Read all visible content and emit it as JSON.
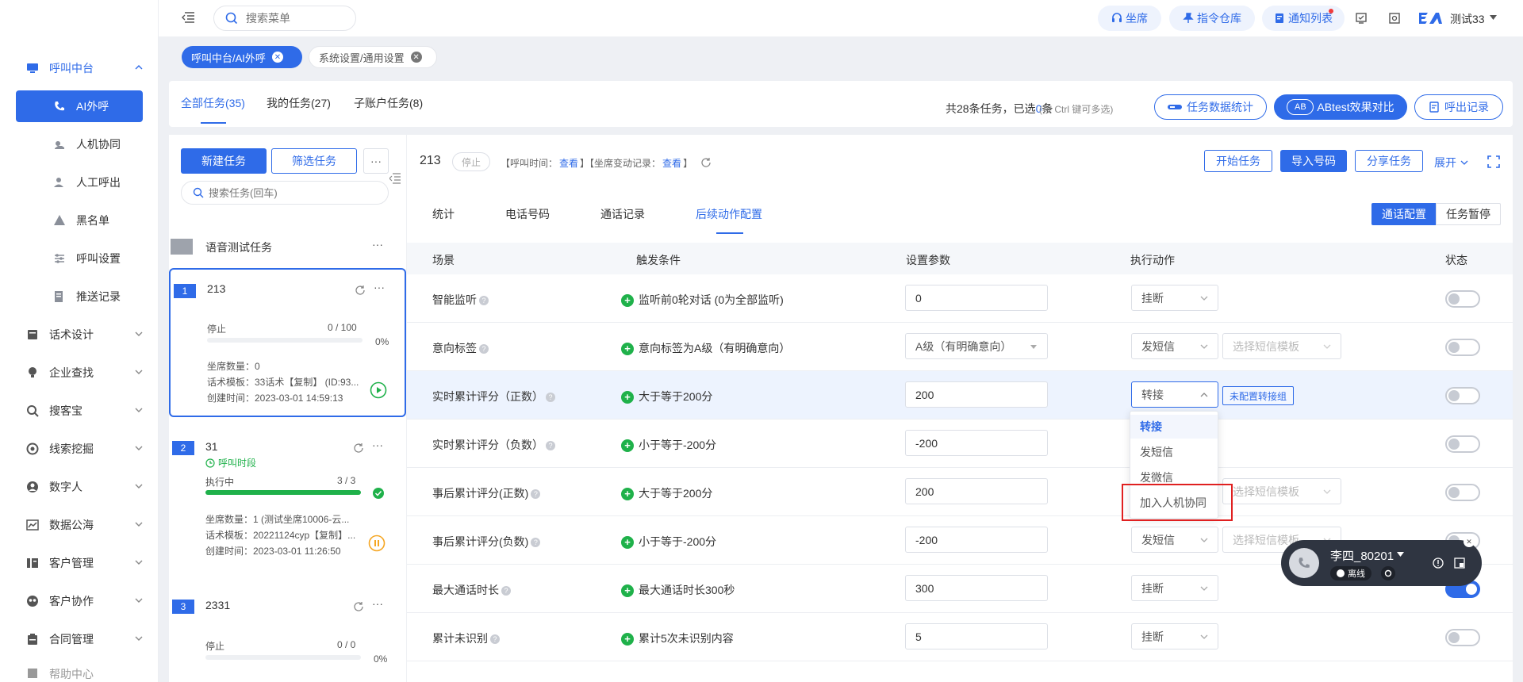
{
  "topbar": {
    "search_placeholder": "搜索菜单",
    "pills": [
      "坐席",
      "指令仓库",
      "通知列表"
    ],
    "user_name": "测试33",
    "logo_text": "E/"
  },
  "sidebar": {
    "items": [
      {
        "label": "呼叫中台",
        "type": "parent-open",
        "icon": "monitor-icon"
      },
      {
        "label": "AI外呼",
        "type": "active",
        "icon": "phone-icon"
      },
      {
        "label": "人机协同",
        "type": "sub",
        "icon": "hand-icon"
      },
      {
        "label": "人工呼出",
        "type": "sub",
        "icon": "user-icon"
      },
      {
        "label": "黑名单",
        "type": "sub",
        "icon": "warning-icon"
      },
      {
        "label": "呼叫设置",
        "type": "sub",
        "icon": "sliders-icon"
      },
      {
        "label": "推送记录",
        "type": "sub",
        "icon": "record-icon"
      },
      {
        "label": "话术设计",
        "type": "parent",
        "icon": "script-icon"
      },
      {
        "label": "企业查找",
        "type": "parent",
        "icon": "bulb-icon"
      },
      {
        "label": "搜客宝",
        "type": "parent",
        "icon": "search-icon"
      },
      {
        "label": "线索挖掘",
        "type": "parent",
        "icon": "target-icon"
      },
      {
        "label": "数字人",
        "type": "parent",
        "icon": "robot-icon"
      },
      {
        "label": "数据公海",
        "type": "parent",
        "icon": "chart-icon"
      },
      {
        "label": "客户管理",
        "type": "parent",
        "icon": "customer-icon"
      },
      {
        "label": "客户协作",
        "type": "parent",
        "icon": "team-icon"
      },
      {
        "label": "合同管理",
        "type": "parent",
        "icon": "contract-icon"
      },
      {
        "label": "帮助中心",
        "type": "parent-cut",
        "icon": "help-icon"
      }
    ]
  },
  "tags": [
    {
      "label": "呼叫中台/AI外呼",
      "active": true
    },
    {
      "label": "系统设置/通用设置",
      "active": false
    }
  ],
  "task_header": {
    "tabs": [
      "全部任务(35)",
      "我的任务(27)",
      "子账户任务(8)"
    ],
    "summary_prefix": "共28条任务，已选",
    "selected_count": "0",
    "summary_suffix": "条",
    "hint": "(按 Ctrl 键可多选)",
    "buttons": [
      "任务数据统计",
      "ABtest效果对比",
      "呼出记录"
    ],
    "ab_icon": "AB"
  },
  "left_panel": {
    "new_task": "新建任务",
    "filter_task": "筛选任务",
    "more": "···",
    "search_placeholder": "搜索任务(回车)",
    "group_name": "语音测试任务",
    "tasks": [
      {
        "num": "1",
        "name": "213",
        "status": "停止",
        "progress": "0 / 100",
        "percent": "0%",
        "fill": 0,
        "seats": "坐席数量：0",
        "template": "话术模板：33话术【复制】 (ID:93...",
        "created": "创建时间：2023-03-01 14:59:13",
        "selected": true
      },
      {
        "num": "2",
        "name": "31",
        "sub_status": "呼叫时段",
        "status": "执行中",
        "progress": "3 / 3",
        "percent": "",
        "fill": 1,
        "seats": "坐席数量：1 (测试坐席10006-云...",
        "template": "话术模板：20221124cyp【复制】...",
        "created": "创建时间：2023-03-01 11:26:50",
        "selected": false
      },
      {
        "num": "3",
        "name": "2331",
        "status": "停止",
        "progress": "0 / 0",
        "percent": "0%",
        "fill": 0,
        "selected": false
      }
    ]
  },
  "right_panel": {
    "task_name": "213",
    "status_badge": "停止",
    "call_time_label": "【呼叫时间：",
    "view1": "查看",
    "mid_bracket": "】【坐席变动记录：",
    "view2": "查看",
    "end_bracket": "】",
    "buttons": [
      "开始任务",
      "导入号码",
      "分享任务"
    ],
    "expand": "展开",
    "tabs": [
      "统计",
      "电话号码",
      "通话记录",
      "后续动作配置"
    ],
    "active_tab": 3,
    "toggle_btns": [
      "通话配置",
      "任务暂停"
    ],
    "columns": [
      "场景",
      "触发条件",
      "设置参数",
      "执行动作",
      "状态"
    ],
    "rows": [
      {
        "scene": "智能监听",
        "help": true,
        "trigger": "监听前0轮对话 (0为全部监听)",
        "param": "0",
        "param_type": "input",
        "action": "挂断",
        "action2": "",
        "extra": "",
        "on": false
      },
      {
        "scene": "意向标签",
        "help": true,
        "trigger": "意向标签为A级（有明确意向）",
        "param": "A级（有明确意向）",
        "param_type": "select",
        "action": "发短信",
        "action2": "选择短信模板",
        "extra": "",
        "on": false
      },
      {
        "scene": "实时累计评分（正数）",
        "help": true,
        "trigger": "大于等于200分",
        "param": "200",
        "param_type": "input",
        "action": "转接",
        "action2": "",
        "extra": "未配置转接组",
        "on": false,
        "highlight": true,
        "open": true
      },
      {
        "scene": "实时累计评分（负数）",
        "help": true,
        "trigger": "小于等于-200分",
        "param": "-200",
        "param_type": "input",
        "action": "",
        "action2": "",
        "extra": "",
        "on": false
      },
      {
        "scene": "事后累计评分(正数)",
        "help": true,
        "trigger": "大于等于200分",
        "param": "200",
        "param_type": "input",
        "action": "",
        "action2": "选择短信模板",
        "extra": "",
        "on": false
      },
      {
        "scene": "事后累计评分(负数)",
        "help": true,
        "trigger": "小于等于-200分",
        "param": "-200",
        "param_type": "input",
        "action": "发短信",
        "action2": "选择短信模板",
        "extra": "",
        "on": false
      },
      {
        "scene": "最大通话时长",
        "help": true,
        "trigger": "最大通话时长300秒",
        "param": "300",
        "param_type": "input",
        "action": "挂断",
        "action2": "",
        "extra": "",
        "on": true
      },
      {
        "scene": "累计未识别",
        "help": true,
        "trigger": "累计5次未识别内容",
        "param": "5",
        "param_type": "input",
        "action": "挂断",
        "action2": "",
        "extra": "",
        "on": false
      }
    ],
    "dropdown": [
      "转接",
      "发短信",
      "发微信",
      "加入人机协同"
    ]
  },
  "phone_widget": {
    "name": "李四_80201",
    "status": "离线"
  },
  "colors": {
    "accent": "#2f6be8",
    "success": "#1fb14a",
    "warning": "#f5a623",
    "highlight_row": "#edf3fe",
    "red_box": "#e02020"
  }
}
